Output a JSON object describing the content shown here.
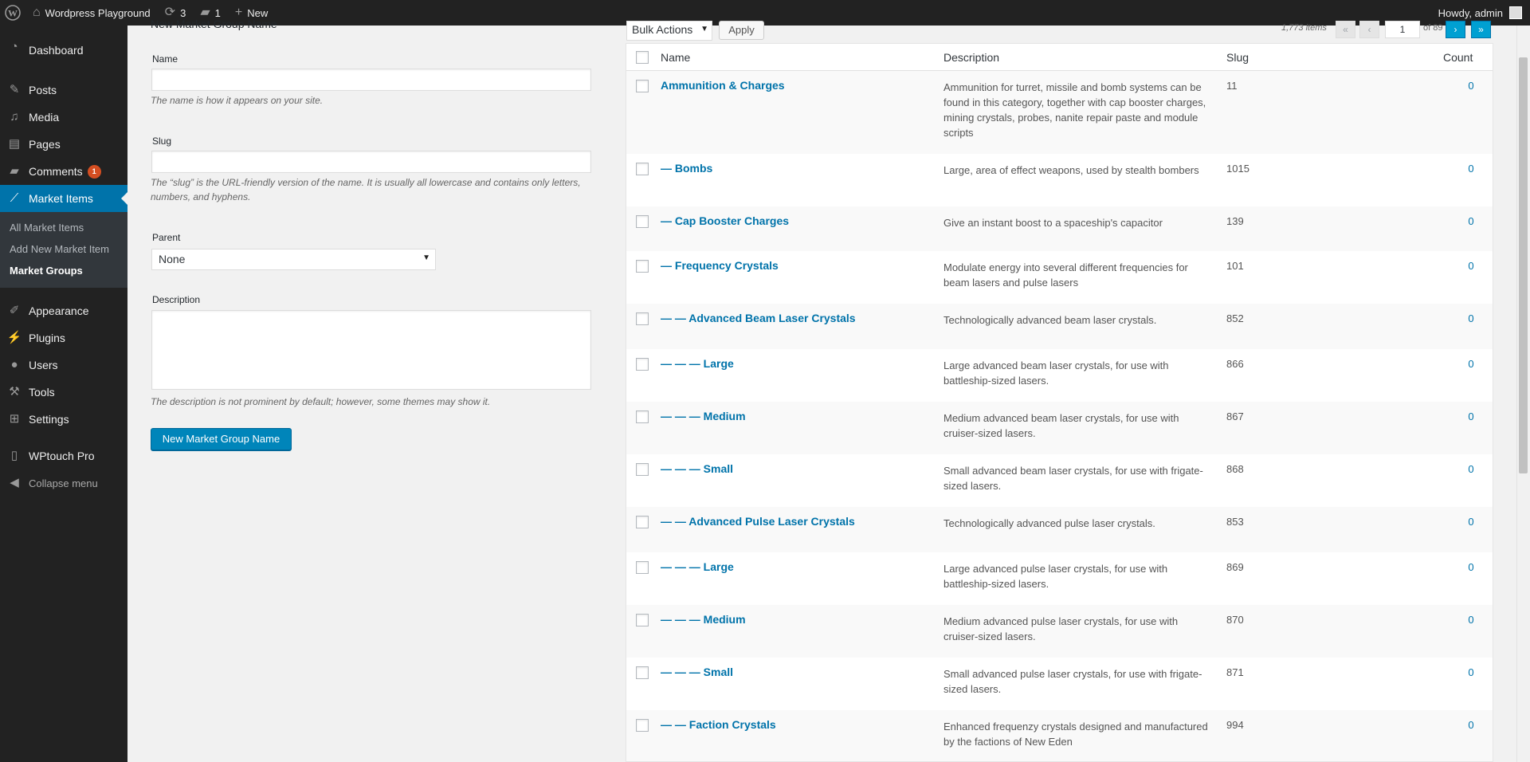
{
  "adminbar": {
    "site_name": "Wordpress Playground",
    "updates_count": "3",
    "comments_count": "1",
    "new_label": "New",
    "howdy": "Howdy, admin"
  },
  "sidebar": {
    "items": [
      {
        "label": "Dashboard",
        "icon": "dashboard-icon"
      },
      {
        "label": "Posts",
        "icon": "pin-icon"
      },
      {
        "label": "Media",
        "icon": "media-icon"
      },
      {
        "label": "Pages",
        "icon": "pages-icon"
      },
      {
        "label": "Comments",
        "icon": "comment-icon",
        "badge": "1"
      },
      {
        "label": "Market Items",
        "icon": "chart-icon"
      },
      {
        "label": "Appearance",
        "icon": "brush-icon"
      },
      {
        "label": "Plugins",
        "icon": "plug-icon"
      },
      {
        "label": "Users",
        "icon": "user-icon"
      },
      {
        "label": "Tools",
        "icon": "wrench-icon"
      },
      {
        "label": "Settings",
        "icon": "settings-icon"
      },
      {
        "label": "WPtouch Pro",
        "icon": "phone-icon"
      },
      {
        "label": "Collapse menu",
        "icon": "collapse-icon"
      }
    ],
    "submenu": [
      "All Market Items",
      "Add New Market Item",
      "Market Groups"
    ]
  },
  "form": {
    "title": "New Market Group Name",
    "name_label": "Name",
    "name_hint": "The name is how it appears on your site.",
    "slug_label": "Slug",
    "slug_hint": "The “slug” is the URL-friendly version of the name. It is usually all lowercase and contains only letters, numbers, and hyphens.",
    "parent_label": "Parent",
    "parent_value": "None",
    "description_label": "Description",
    "description_hint": "The description is not prominent by default; however, some themes may show it.",
    "submit_label": "New Market Group Name"
  },
  "tablenav": {
    "bulk_actions": "Bulk Actions",
    "apply": "Apply",
    "items_count": "1,773 items",
    "first": "«",
    "prev": "‹",
    "current_page": "1",
    "of_pages": "of 89",
    "next": "›",
    "last": "»"
  },
  "table": {
    "headers": {
      "name": "Name",
      "description": "Description",
      "slug": "Slug",
      "count": "Count"
    },
    "rows": [
      {
        "name": "Ammunition & Charges",
        "description": "Ammunition for turret, missile and bomb systems can be found in this category, together with cap booster charges, mining crystals, probes, nanite repair paste and module scripts",
        "slug": "11",
        "count": "0"
      },
      {
        "name": "— Bombs",
        "description": "Large, area of effect weapons, used by stealth bombers",
        "slug": "1015",
        "count": "0"
      },
      {
        "name": "— Cap Booster Charges",
        "description": "Give an instant boost to a spaceship's capacitor",
        "slug": "139",
        "count": "0"
      },
      {
        "name": "— Frequency Crystals",
        "description": "Modulate energy into several different frequencies for beam lasers and pulse lasers",
        "slug": "101",
        "count": "0"
      },
      {
        "name": "— — Advanced Beam Laser Crystals",
        "description": "Technologically advanced beam laser crystals.",
        "slug": "852",
        "count": "0"
      },
      {
        "name": "— — — Large",
        "description": "Large advanced beam laser crystals, for use with battleship-sized lasers.",
        "slug": "866",
        "count": "0"
      },
      {
        "name": "— — — Medium",
        "description": "Medium advanced beam laser crystals, for use with cruiser-sized lasers.",
        "slug": "867",
        "count": "0"
      },
      {
        "name": "— — — Small",
        "description": "Small advanced beam laser crystals, for use with frigate-sized lasers.",
        "slug": "868",
        "count": "0"
      },
      {
        "name": "— — Advanced Pulse Laser Crystals",
        "description": "Technologically advanced pulse laser crystals.",
        "slug": "853",
        "count": "0"
      },
      {
        "name": "— — — Large",
        "description": "Large advanced pulse laser crystals, for use with battleship-sized lasers.",
        "slug": "869",
        "count": "0"
      },
      {
        "name": "— — — Medium",
        "description": "Medium advanced pulse laser crystals, for use with cruiser-sized lasers.",
        "slug": "870",
        "count": "0"
      },
      {
        "name": "— — — Small",
        "description": "Small advanced pulse laser crystals, for use with frigate-sized lasers.",
        "slug": "871",
        "count": "0"
      },
      {
        "name": "— — Faction Crystals",
        "description": "Enhanced frequenzy crystals designed and manufactured by the factions of New Eden",
        "slug": "994",
        "count": "0"
      }
    ]
  },
  "colors": {
    "accent": "#0073aa",
    "primary_button": "#0085ba",
    "sidebar_bg": "#222222",
    "badge": "#d54e21"
  }
}
